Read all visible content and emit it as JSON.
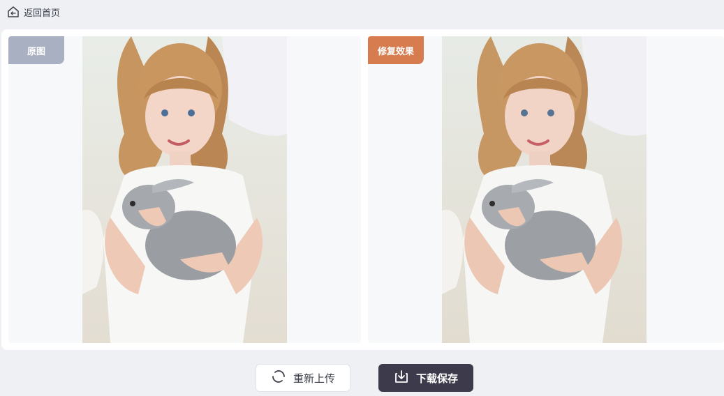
{
  "nav": {
    "back_label": "返回首页"
  },
  "compare": {
    "original_label": "原图",
    "result_label": "修复效果"
  },
  "actions": {
    "reupload_label": "重新上传",
    "download_label": "下载保存"
  },
  "icons": {
    "back": "home-back-icon",
    "reupload": "refresh-icon",
    "download": "download-icon"
  },
  "colors": {
    "original_tag": "#a9b0c1",
    "result_tag": "#d67c4f",
    "download_button": "#3d3a4b"
  }
}
